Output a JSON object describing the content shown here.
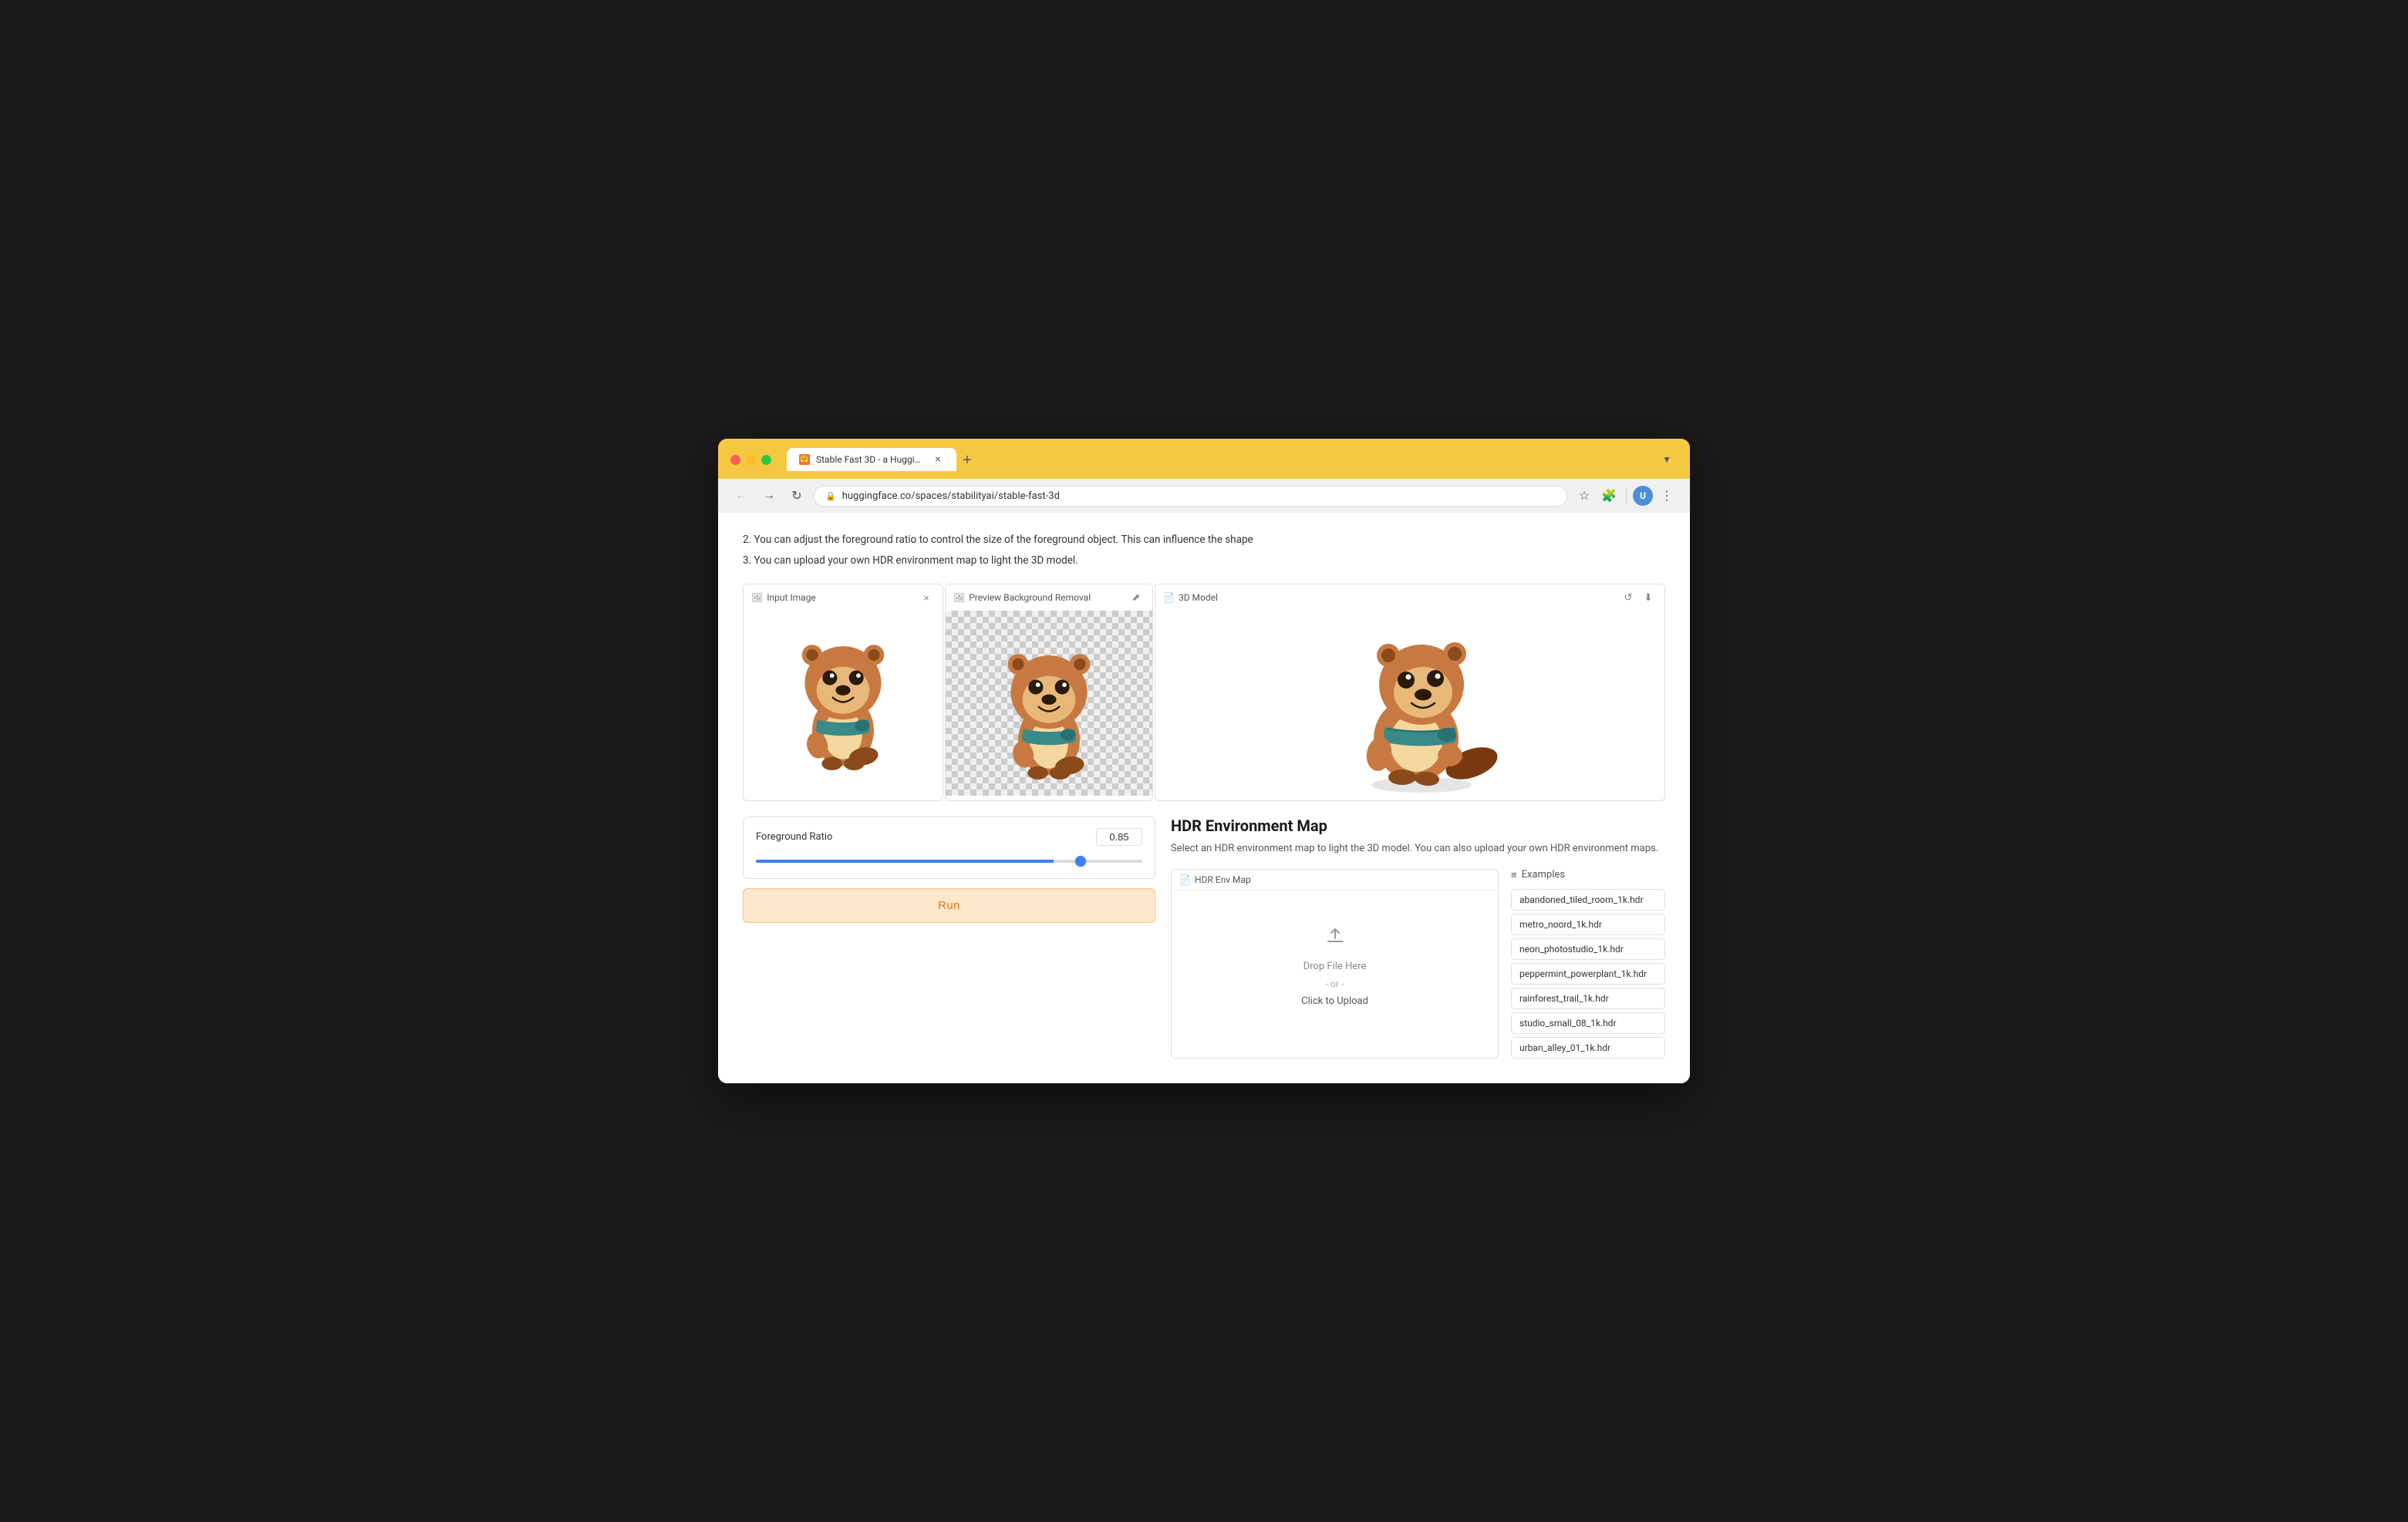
{
  "browser": {
    "traffic_lights": {
      "close_label": "close",
      "minimize_label": "minimize",
      "maximize_label": "maximize"
    },
    "tab": {
      "title": "Stable Fast 3D - a Hugging F...",
      "favicon_label": "HF"
    },
    "tab_new_label": "+",
    "address": "huggingface.co/spaces/stabilityai/stable-fast-3d",
    "back_label": "←",
    "forward_label": "→",
    "refresh_label": "↻"
  },
  "page": {
    "notes": [
      "2. You can adjust the foreground ratio to control the size of the foreground object. This can influence the shape",
      "3. You can upload your own HDR environment map to light the 3D model."
    ],
    "panels": {
      "input": {
        "label": "Input Image",
        "close_label": "×"
      },
      "preview": {
        "label": "Preview Background Removal",
        "share_label": "⬈"
      },
      "model3d": {
        "label": "3D Model",
        "refresh_label": "↺",
        "download_label": "⬇"
      }
    },
    "controls": {
      "foreground_ratio": {
        "label": "Foreground Ratio",
        "value": "0.85",
        "min": 0,
        "max": 1,
        "step": 0.01,
        "fill_percent": 77
      },
      "run_button_label": "Run"
    },
    "hdr": {
      "title": "HDR Environment Map",
      "description": "Select an HDR environment map to light the 3D model. You can also upload your own HDR environment maps.",
      "upload_panel": {
        "label": "HDR Env Map",
        "drop_label": "Drop File Here",
        "or_label": "- or -",
        "click_label": "Click to Upload"
      },
      "examples_header": "≡ Examples",
      "examples": [
        "abandoned_tiled_room_1k.hdr",
        "metro_noord_1k.hdr",
        "neon_photostudio_1k.hdr",
        "peppermint_powerplant_1k.hdr",
        "rainforest_trail_1k.hdr",
        "studio_small_08_1k.hdr",
        "urban_alley_01_1k.hdr"
      ]
    }
  }
}
